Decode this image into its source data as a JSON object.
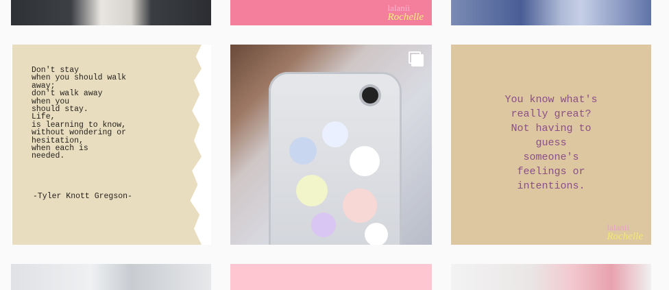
{
  "grid": {
    "row1": {
      "left": {
        "alt": ""
      },
      "middle": {
        "logo_line1": "lalanii",
        "logo_line2": "Rochelle"
      },
      "right": {
        "alt": ""
      }
    },
    "row2": {
      "left": {
        "poem": "Don't stay\nwhen you should walk\naway;\ndon't walk away\nwhen you\nshould stay.\nLife,\nis learning to know,\nwithout wondering or\nhesitation,\nwhen each is\nneeded.",
        "author": "-Tyler Knott Gregson-"
      },
      "middle": {
        "icon": "multiple-images-icon"
      },
      "right": {
        "quote": "You know what's\nreally great?\nNot having to\nguess\nsomeone's\nfeelings or\nintentions.",
        "logo_line1": "lalanii",
        "logo_line2": "Rochelle"
      }
    }
  },
  "colors": {
    "pink": "#f47f9c",
    "beige": "#dcc7a0",
    "quote_text": "#8a4e86",
    "background": "#fafafa"
  }
}
